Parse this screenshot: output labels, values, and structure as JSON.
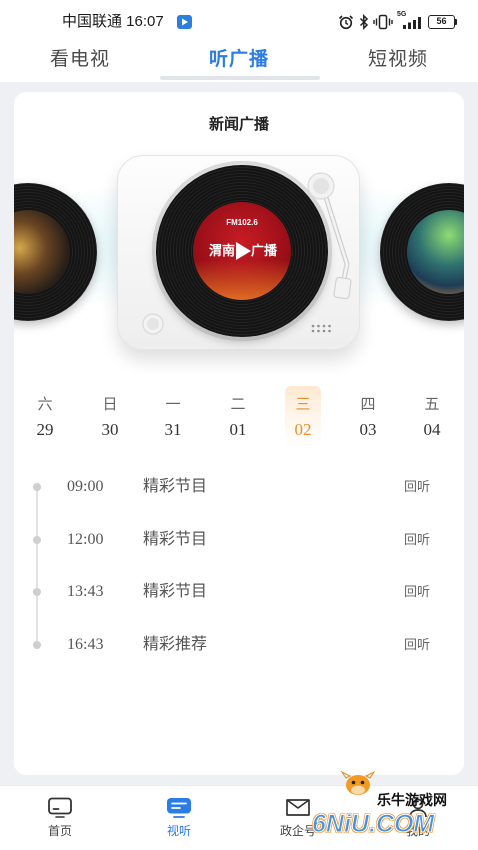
{
  "status_bar": {
    "carrier_time": "中国联通 16:07",
    "network": "5G",
    "battery": "56"
  },
  "top_tabs": [
    {
      "label": "看电视",
      "active": false
    },
    {
      "label": "听广播",
      "active": true
    },
    {
      "label": "短视频",
      "active": false
    }
  ],
  "station": {
    "title": "新闻广播",
    "record_freq": "FM102.6",
    "record_name_left": "渭南",
    "record_name_right": "广播"
  },
  "days": [
    {
      "weekday": "六",
      "date": "29",
      "selected": false
    },
    {
      "weekday": "日",
      "date": "30",
      "selected": false
    },
    {
      "weekday": "一",
      "date": "31",
      "selected": false
    },
    {
      "weekday": "二",
      "date": "01",
      "selected": false
    },
    {
      "weekday": "三",
      "date": "02",
      "selected": true
    },
    {
      "weekday": "四",
      "date": "03",
      "selected": false
    },
    {
      "weekday": "五",
      "date": "04",
      "selected": false
    }
  ],
  "schedule": [
    {
      "time": "09:00",
      "program": "精彩节目",
      "action": "回听"
    },
    {
      "time": "12:00",
      "program": "精彩节目",
      "action": "回听"
    },
    {
      "time": "13:43",
      "program": "精彩节目",
      "action": "回听"
    },
    {
      "time": "16:43",
      "program": "精彩推荐",
      "action": "回听"
    }
  ],
  "bottom_nav": [
    {
      "label": "首页",
      "icon": "home-tv-icon",
      "active": false
    },
    {
      "label": "视听",
      "icon": "audio-video-icon",
      "active": true
    },
    {
      "label": "政企号",
      "icon": "mail-icon",
      "active": false
    },
    {
      "label": "我的",
      "icon": "profile-icon",
      "active": false
    }
  ],
  "watermark": {
    "site_name": "乐牛游戏网",
    "logo_text": "6NiU.COM"
  },
  "colors": {
    "accent": "#2b7ce6",
    "highlight": "#e8902c",
    "page_bg": "#eef0f3"
  }
}
